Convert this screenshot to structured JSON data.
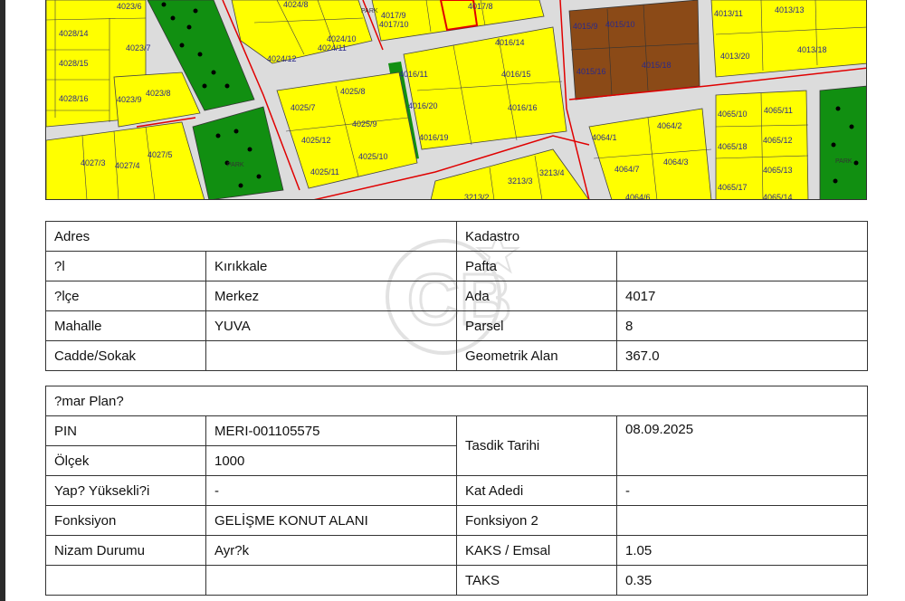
{
  "map": {
    "parcel_labels": [
      "4023/6",
      "4028/14",
      "4028/15",
      "4028/16",
      "4023/7",
      "4023/8",
      "4023/9",
      "4024/8",
      "4024/10",
      "4024/11",
      "4024/12",
      "4017/9",
      "4017/10",
      "4017/8",
      "4016/14",
      "4016/11",
      "4016/15",
      "4016/20",
      "4016/16",
      "4016/19",
      "4015/9",
      "4015/10",
      "4015/16",
      "4015/18",
      "4013/11",
      "4013/13",
      "4013/20",
      "4013/18",
      "4025/7",
      "4025/8",
      "4025/9",
      "4025/12",
      "4025/10",
      "4025/11",
      "4027/3",
      "4027/4",
      "4027/5",
      "3213/4",
      "3213/3",
      "3213/2",
      "4064/2",
      "4064/1",
      "4064/7",
      "4064/3",
      "4064/6",
      "4065/10",
      "4065/11",
      "4065/18",
      "4065/12",
      "4065/13",
      "4065/17",
      "4065/14"
    ],
    "park_labels": [
      "PARK",
      "PARK",
      "PARK"
    ]
  },
  "table1": {
    "left_header": "Adres",
    "right_header": "Kadastro",
    "rows": [
      {
        "k1": "?l",
        "v1": "Kırıkkale",
        "k2": "Pafta",
        "v2": ""
      },
      {
        "k1": "?lçe",
        "v1": "Merkez",
        "k2": "Ada",
        "v2": "4017"
      },
      {
        "k1": "Mahalle",
        "v1": "YUVA",
        "k2": "Parsel",
        "v2": "8"
      },
      {
        "k1": "Cadde/Sokak",
        "v1": "",
        "k2": "Geometrik Alan",
        "v2": "367.0"
      }
    ]
  },
  "table2": {
    "header": "?mar Plan?",
    "pin_label": "PIN",
    "pin_value": "MERI-001105575",
    "olcek_label": "Ölçek",
    "olcek_value": "1000",
    "tasdik_label": "Tasdik Tarihi",
    "tasdik_value": "08.09.2025",
    "yukseklik_label": "Yap? Yüksekli?i",
    "yukseklik_value": "-",
    "kat_label": "Kat Adedi",
    "kat_value": "-",
    "fonksiyon_label": "Fonksiyon",
    "fonksiyon_value": "GELİŞME KONUT ALANI",
    "fonksiyon2_label": "Fonksiyon 2",
    "fonksiyon2_value": "",
    "nizam_label": "Nizam Durumu",
    "nizam_value": "Ayr?k",
    "kaks_label": "KAKS / Emsal",
    "kaks_value": "1.05",
    "taks_label": "TAKS",
    "taks_value": "0.35"
  },
  "colors": {
    "yellow": "#ffff00",
    "road": "#d8d8d8",
    "red_line": "#e00000",
    "park": "#118f11",
    "brown": "#8b4a17"
  },
  "watermark": {
    "text": "CB"
  }
}
